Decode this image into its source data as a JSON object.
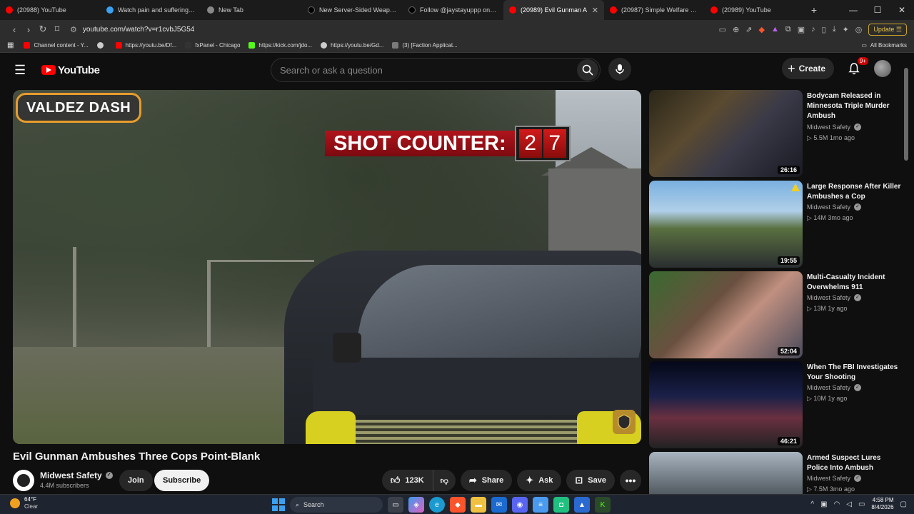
{
  "browser": {
    "tabs": [
      {
        "title": "(20988) YouTube",
        "color": "#ff0000",
        "active": false
      },
      {
        "title": "Watch pain and suffering | Str",
        "color": "#3aa0f0",
        "active": false
      },
      {
        "title": "New Tab",
        "color": "#888888",
        "active": false
      },
      {
        "title": "New Server-Sided Weapon Ar",
        "color": "#000000",
        "active": false
      },
      {
        "title": "Follow @jaystayuppp on Twit",
        "color": "#000000",
        "active": false
      },
      {
        "title": "(20989) Evil Gunman A",
        "color": "#ff0000",
        "active": true
      },
      {
        "title": "(20987) Simple Welfare Check",
        "color": "#ff0000",
        "active": false
      },
      {
        "title": "(20989) YouTube",
        "color": "#ff0000",
        "active": false
      }
    ],
    "url": "youtube.com/watch?v=r1cvbJ5G54",
    "update_label": "Update",
    "bookmarks": [
      {
        "label": "Channel content - Y...",
        "color": "#ff0000"
      },
      {
        "label": "",
        "color": "#cccccc"
      },
      {
        "label": "https://youtu.be/Df...",
        "color": "#ff0000"
      },
      {
        "label": "fxPanel - Chicago",
        "color": "#333333"
      },
      {
        "label": "https://kick.com/jdo...",
        "color": "#53fc18"
      },
      {
        "label": "https://youtu.be/Gd...",
        "color": "#cccccc"
      },
      {
        "label": "(3) [Faction Applicat...",
        "color": "#7a7a7a"
      }
    ],
    "all_bookmarks": "All Bookmarks"
  },
  "header": {
    "logo": "YouTube",
    "search_placeholder": "Search or ask a question",
    "create_label": "Create",
    "notification_count": "9+"
  },
  "video": {
    "overlay_tag": "VALDEZ DASH",
    "shot_counter_label": "SHOT COUNTER:",
    "shot_digits": [
      "2",
      "7"
    ],
    "title": "Evil Gunman Ambushes Three Cops Point-Blank",
    "channel": "Midwest Safety",
    "subscribers": "4.4M subscribers",
    "join_label": "Join",
    "subscribe_label": "Subscribe",
    "likes": "123K",
    "share_label": "Share",
    "ask_label": "Ask",
    "save_label": "Save"
  },
  "recommendations": [
    {
      "title": "Bodycam Released in Minnesota Triple Murder Ambush",
      "channel": "Midwest Safety",
      "meta": "5.5M  1mo ago",
      "duration": "26:16"
    },
    {
      "title": "Large Response After Killer Ambushes a Cop",
      "channel": "Midwest Safety",
      "meta": "14M  3mo ago",
      "duration": "19:55"
    },
    {
      "title": "Multi-Casualty Incident Overwhelms 911",
      "channel": "Midwest Safety",
      "meta": "13M  1y ago",
      "duration": "52:04"
    },
    {
      "title": "When The FBI Investigates Your Shooting",
      "channel": "Midwest Safety",
      "meta": "10M  1y ago",
      "duration": "46:21"
    },
    {
      "title": "Armed Suspect Lures Police Into Ambush",
      "channel": "Midwest Safety",
      "meta": "7.5M  3mo ago",
      "duration": ""
    }
  ],
  "taskbar": {
    "temp": "64°F",
    "condition": "Clear",
    "search_label": "Search",
    "time": "4:58 PM",
    "date": "8/4/2026"
  }
}
